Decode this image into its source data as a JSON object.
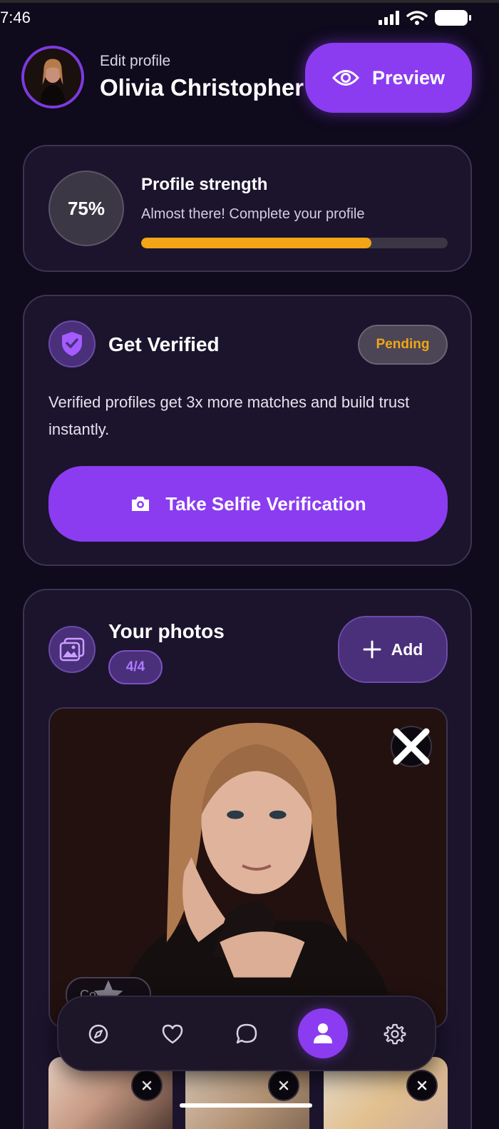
{
  "status_bar": {
    "time": "7:46"
  },
  "header": {
    "subtitle": "Edit profile",
    "name": "Olivia Christopher",
    "preview_label": "Preview"
  },
  "profile_strength": {
    "percent_label": "75%",
    "percent": 75,
    "title": "Profile strength",
    "subtitle": "Almost there! Complete your profile",
    "bar_color": "#f2a516"
  },
  "verification": {
    "title": "Get Verified",
    "status": "Pending",
    "description": "Verified profiles get 3x more matches and build trust instantly.",
    "button_label": "Take Selfie Verification"
  },
  "photos": {
    "title": "Your photos",
    "count": "4/4",
    "add_label": "Add",
    "cover_label": "Cover"
  },
  "bottom_nav": {
    "items": [
      "compass-icon",
      "heart-icon",
      "chat-icon",
      "profile-icon",
      "settings-icon"
    ],
    "active": "profile-icon"
  },
  "colors": {
    "accent": "#8b3cf0",
    "background": "#0f0a1c",
    "card": "#1b142c",
    "warning": "#f2a516"
  }
}
